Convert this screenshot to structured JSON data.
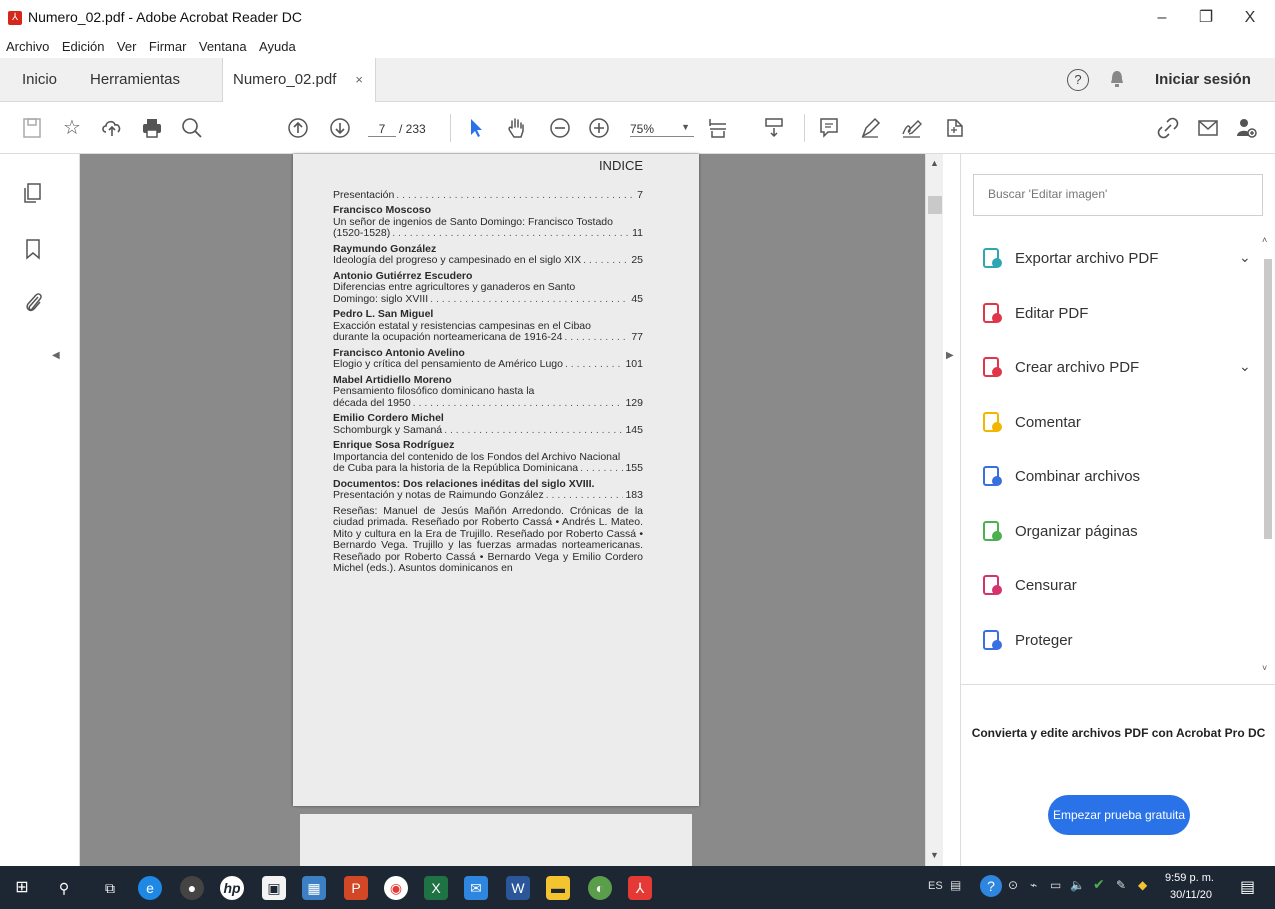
{
  "window": {
    "title": "Numero_02.pdf - Adobe Acrobat Reader DC",
    "minimize": "–",
    "maximize": "❐",
    "close": "X"
  },
  "menu": [
    "Archivo",
    "Edición",
    "Ver",
    "Firmar",
    "Ventana",
    "Ayuda"
  ],
  "tabs": {
    "home": "Inicio",
    "tools": "Herramientas",
    "doc": "Numero_02.pdf",
    "close": "×",
    "signin": "Iniciar sesión"
  },
  "toolbar": {
    "page_current": "7",
    "page_total": "/ 233",
    "zoom": "75%"
  },
  "document": {
    "heading": "INDICE",
    "entries": [
      {
        "author": "",
        "lines": [
          "Presentación"
        ],
        "page": "7"
      },
      {
        "author": "Francisco Moscoso",
        "lines": [
          "Un señor de ingenios de Santo Domingo: Francisco Tostado",
          "(1520-1528)"
        ],
        "page": "11"
      },
      {
        "author": "Raymundo González",
        "lines": [
          "Ideología del progreso y campesinado en el siglo XIX"
        ],
        "page": "25"
      },
      {
        "author": "Antonio Gutiérrez Escudero",
        "lines": [
          "Diferencias entre agricultores y ganaderos en Santo",
          "Domingo: siglo XVIII"
        ],
        "page": "45"
      },
      {
        "author": "Pedro L. San Miguel",
        "lines": [
          "Exacción estatal y resistencias campesinas en el Cibao",
          "durante la ocupación norteamericana de 1916-24"
        ],
        "page": "77"
      },
      {
        "author": "Francisco Antonio Avelino",
        "lines": [
          "Elogio y crítica del pensamiento de Américo Lugo"
        ],
        "page": "101"
      },
      {
        "author": "Mabel Artidiello Moreno",
        "lines": [
          "Pensamiento filosófico dominicano hasta la",
          "década del 1950"
        ],
        "page": "129"
      },
      {
        "author": "Emilio Cordero Michel",
        "lines": [
          "Schomburgk y Samaná"
        ],
        "page": "145"
      },
      {
        "author": "Enrique Sosa Rodríguez",
        "lines": [
          "Importancia del contenido de los Fondos del Archivo Nacional",
          "de Cuba para la historia de la República Dominicana"
        ],
        "page": "155"
      },
      {
        "author": "Documentos: Dos relaciones inéditas del siglo XVIII.",
        "lines": [
          "Presentación y notas de Raimundo González"
        ],
        "page": "183"
      }
    ],
    "resenas": "Reseñas: Manuel de Jesús Mañón Arredondo. Crónicas de la ciudad primada. Reseñado por Roberto Cassá • Andrés L. Mateo. Mito y cultura en la Era de Trujillo. Reseñado por Roberto Cassá • Bernardo Vega. Trujillo y las fuerzas armadas norteamericanas. Reseñado por Roberto Cassá • Bernardo Vega y Emilio Cordero Michel (eds.). Asuntos dominicanos en"
  },
  "rightpane": {
    "search_placeholder": "Buscar 'Editar imagen'",
    "tools": [
      {
        "label": "Exportar archivo PDF",
        "icon": "export-pdf-icon",
        "color": "#2fa7b3",
        "chevron": true
      },
      {
        "label": "Editar PDF",
        "icon": "edit-pdf-icon",
        "color": "#e0364a",
        "chevron": false
      },
      {
        "label": "Crear archivo PDF",
        "icon": "create-pdf-icon",
        "color": "#e0364a",
        "chevron": true
      },
      {
        "label": "Comentar",
        "icon": "comment-icon",
        "color": "#f2b600",
        "chevron": false
      },
      {
        "label": "Combinar archivos",
        "icon": "combine-files-icon",
        "color": "#3a6fe0",
        "chevron": false
      },
      {
        "label": "Organizar páginas",
        "icon": "organize-pages-icon",
        "color": "#4caf50",
        "chevron": false
      },
      {
        "label": "Censurar",
        "icon": "redact-icon",
        "color": "#d4336e",
        "chevron": false
      },
      {
        "label": "Proteger",
        "icon": "protect-icon",
        "color": "#3a6fe0",
        "chevron": false
      }
    ],
    "chevron": "⌄",
    "promo": "Convierta y edite archivos PDF con Acrobat Pro DC",
    "trial_button": "Empezar prueba gratuita"
  },
  "taskbar": {
    "lang": "ES",
    "time": "9:59 p. m.",
    "date": "30/11/20"
  },
  "colors": {
    "accent": "#2a72e8",
    "taskbar": "#1d2733"
  }
}
